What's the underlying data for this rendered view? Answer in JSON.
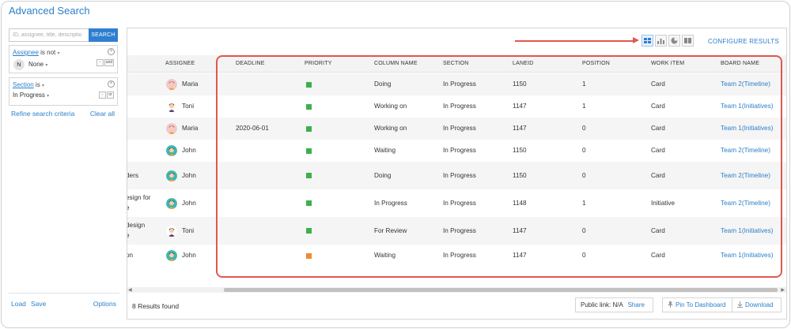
{
  "page_title": "Advanced Search",
  "search": {
    "placeholder": "ID, assignee, title, descriptio",
    "button_label": "SEARCH"
  },
  "filters": [
    {
      "field": "Assignee",
      "operator": "is not",
      "value": "None",
      "avatar_letter": "N",
      "toggle_label": "and"
    },
    {
      "field": "Section",
      "operator": "is",
      "value": "In Progress",
      "toggle_label": "or"
    }
  ],
  "refine_label": "Refine search criteria",
  "clear_all_label": "Clear all",
  "left_footer": {
    "load": "Load",
    "save": "Save",
    "options": "Options"
  },
  "toolbar": {
    "views": [
      "table-view-icon",
      "bar-chart-view-icon",
      "pie-chart-view-icon",
      "card-view-icon"
    ],
    "configure_label": "CONFIGURE RESULTS"
  },
  "table": {
    "headers": [
      "ASSIGNEE",
      "DEADLINE",
      "PRIORITY",
      "COLUMN NAME",
      "SECTION",
      "LANEID",
      "POSITION",
      "WORK ITEM",
      "BOARD NAME"
    ],
    "rows": [
      {
        "title_cut": [
          "",
          ""
        ],
        "assignee": "Maria",
        "deadline": "",
        "priority_color": "#3db04b",
        "column": "Doing",
        "section": "In Progress",
        "laneid": "1150",
        "position": "1",
        "work_item": "Card",
        "board": "Team 2(Timeline)"
      },
      {
        "title_cut": [
          "",
          ""
        ],
        "assignee": "Toni",
        "deadline": "",
        "priority_color": "#3db04b",
        "column": "Working on",
        "section": "In Progress",
        "laneid": "1147",
        "position": "1",
        "work_item": "Card",
        "board": "Team 1(Initiatives)"
      },
      {
        "title_cut": [
          "",
          ""
        ],
        "assignee": "Maria",
        "deadline": "2020-06-01",
        "priority_color": "#3db04b",
        "column": "Working on",
        "section": "In Progress",
        "laneid": "1147",
        "position": "0",
        "work_item": "Card",
        "board": "Team 1(Initiatives)"
      },
      {
        "title_cut": [
          "",
          ""
        ],
        "assignee": "John",
        "deadline": "",
        "priority_color": "#3db04b",
        "column": "Waiting",
        "section": "In Progress",
        "laneid": "1150",
        "position": "0",
        "work_item": "Card",
        "board": "Team 2(Timeline)"
      },
      {
        "title_cut": [
          "ders",
          ""
        ],
        "assignee": "John",
        "deadline": "",
        "priority_color": "#3db04b",
        "column": "Doing",
        "section": "In Progress",
        "laneid": "1150",
        "position": "0",
        "work_item": "Card",
        "board": "Team 2(Timeline)"
      },
      {
        "title_cut": [
          "esign for",
          "e"
        ],
        "assignee": "John",
        "deadline": "",
        "priority_color": "#3db04b",
        "column": "In Progress",
        "section": "In Progress",
        "laneid": "1148",
        "position": "1",
        "work_item": "Initiative",
        "board": "Team 2(Timeline)"
      },
      {
        "title_cut": [
          "design",
          "e"
        ],
        "assignee": "Toni",
        "deadline": "",
        "priority_color": "#3db04b",
        "column": "For Review",
        "section": "In Progress",
        "laneid": "1147",
        "position": "0",
        "work_item": "Card",
        "board": "Team 1(Initiatives)"
      },
      {
        "title_cut": [
          "on",
          ""
        ],
        "assignee": "John",
        "deadline": "",
        "priority_color": "#f08a2e",
        "column": "Waiting",
        "section": "In Progress",
        "laneid": "1147",
        "position": "0",
        "work_item": "Card",
        "board": "Team 1(Initiatives)"
      }
    ]
  },
  "footer": {
    "results_count": "8 Results found",
    "public_link_label": "Public link: N/A",
    "share_label": "Share",
    "pin_label": "Pin To Dashboard",
    "download_label": "Download"
  },
  "colors": {
    "accent": "#2f7fd1",
    "highlight": "#e0584f",
    "priority_green": "#3db04b",
    "priority_orange": "#f08a2e"
  }
}
